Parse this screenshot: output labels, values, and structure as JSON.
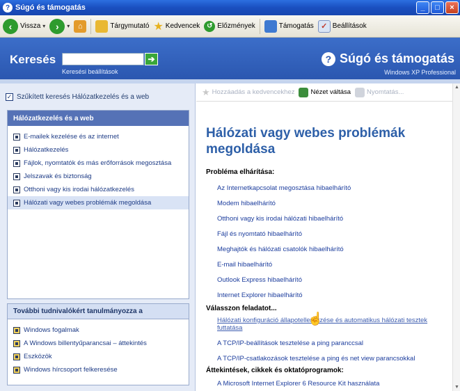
{
  "window": {
    "title": "Súgó és támogatás"
  },
  "toolbar": {
    "back": "Vissza",
    "index": "Tárgymutató",
    "favorites": "Kedvencek",
    "history": "Előzmények",
    "support": "Támogatás",
    "options": "Beállítások"
  },
  "header": {
    "search_label": "Keresés",
    "search_value": "",
    "search_options": "Keresési beállítások",
    "brand": "Súgó és támogatás",
    "edition": "Windows XP Professional"
  },
  "left": {
    "narrow_search": "Szűkített keresés Hálózatkezelés és a web",
    "panel1_title": "Hálózatkezelés és a web",
    "items": [
      "E-mailek kezelése és az internet",
      "Hálózatkezelés",
      "Fájlok, nyomtatók és más erőforrások megosztása",
      "Jelszavak és biztonság",
      "Otthoni vagy kis irodai hálózatkezelés",
      "Hálózati vagy webes problémák megoldása"
    ],
    "panel2_title": "További tudnivalókért tanulmányozza a",
    "more": [
      "Windows fogalmak",
      "A Windows billentyűparancsai – áttekintés",
      "Eszközök",
      "Windows hírcsoport felkeresése"
    ]
  },
  "content": {
    "tool_add_fav": "Hozzáadás a kedvencekhez",
    "tool_view": "Nézet váltása",
    "tool_print": "Nyomtatás...",
    "title": "Hálózati vagy webes problémák megoldása",
    "sec1": "Probléma elhárítása:",
    "troubleshooters": [
      "Az Internetkapcsolat megosztása hibaelhárító",
      "Modem hibaelhárító",
      "Otthoni vagy kis irodai hálózati hibaelhárító",
      "Fájl és nyomtató hibaelhárító",
      "Meghajtók és hálózati csatolók hibaelhárító",
      "E-mail hibaelhárító",
      "Outlook Express hibaelhárító",
      "Internet Explorer hibaelhárító"
    ],
    "sec2": "Válasszon feladatot...",
    "tasks": [
      "Hálózati konfiguráció állapotellenőrzése és automatikus hálózati tesztek futtatása",
      "A TCP/IP-beállítások tesztelése a ping paranccsal",
      "A TCP/IP-csatlakozások tesztelése a ping és net view parancsokkal"
    ],
    "sec3": "Áttekintések, cikkek és oktatóprogramok:",
    "articles": [
      "A Microsoft Internet Explorer 6 Resource Kit használata"
    ]
  },
  "colors": {
    "header": "#2b57b0",
    "title": "#2d5fa8",
    "link": "#1c3d9d"
  }
}
